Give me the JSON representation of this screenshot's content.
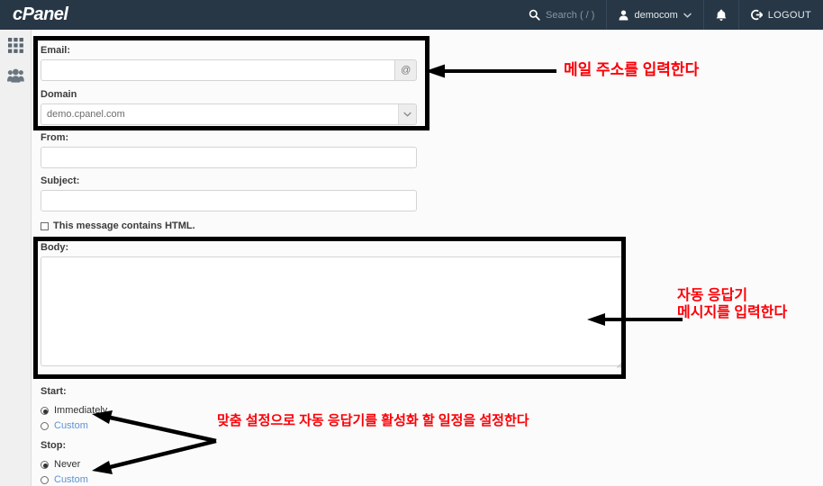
{
  "header": {
    "brand": "cPanel",
    "search": {
      "icon": "search-icon",
      "placeholder": "Search ( / )"
    },
    "user": {
      "icon": "user-icon",
      "name": "democom",
      "caret": "chevron-down-icon"
    },
    "notifications": {
      "icon": "bell-icon"
    },
    "logout": {
      "icon": "logout-icon",
      "label": "LOGOUT"
    }
  },
  "sidebar": {
    "items": [
      {
        "name": "apps-grid-icon",
        "icon": "grid-icon"
      },
      {
        "name": "user-manager-icon",
        "icon": "users-icon"
      }
    ]
  },
  "form": {
    "email": {
      "label": "Email:",
      "value": "",
      "placeholder": "",
      "addon": "@"
    },
    "domain": {
      "label": "Domain",
      "value": "demo.cpanel.com",
      "options": [
        "demo.cpanel.com"
      ]
    },
    "from": {
      "label": "From:",
      "value": "",
      "placeholder": ""
    },
    "subject": {
      "label": "Subject:",
      "value": "",
      "placeholder": ""
    },
    "html_checkbox": {
      "label": "This message contains HTML.",
      "checked": false
    },
    "body": {
      "label": "Body:",
      "value": "",
      "placeholder": ""
    },
    "start": {
      "label": "Start:",
      "options": [
        {
          "label": "Immediately",
          "selected": true,
          "style": "normal"
        },
        {
          "label": "Custom",
          "selected": false,
          "style": "link"
        }
      ]
    },
    "stop": {
      "label": "Stop:",
      "options": [
        {
          "label": "Never",
          "selected": true,
          "style": "normal"
        },
        {
          "label": "Custom",
          "selected": false,
          "style": "link"
        }
      ]
    }
  },
  "annotations": {
    "color": "#fb0007",
    "email": {
      "text": "메일 주소를 입력한다"
    },
    "body": {
      "line1": "자동 응답기",
      "line2": "메시지를 입력한다"
    },
    "schedule": {
      "text": "맞춤 설정으로 자동 응답기를 활성화 할 일정을 설정한다"
    }
  }
}
